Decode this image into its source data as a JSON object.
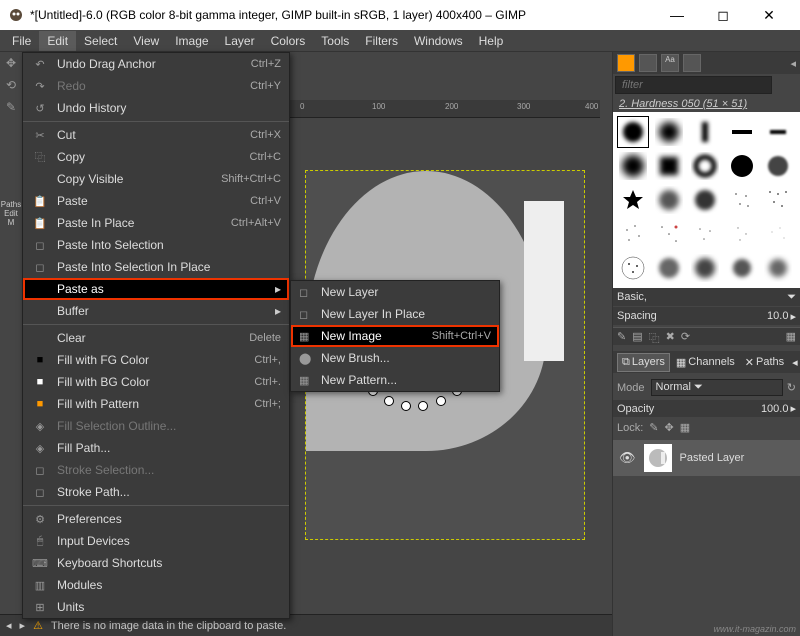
{
  "window": {
    "title": "*[Untitled]-6.0 (RGB color 8-bit gamma integer, GIMP built-in sRGB, 1 layer) 400x400 – GIMP",
    "min": "—",
    "max": "◻",
    "close": "✕"
  },
  "menubar": [
    "File",
    "Edit",
    "Select",
    "View",
    "Image",
    "Layer",
    "Colors",
    "Tools",
    "Filters",
    "Windows",
    "Help"
  ],
  "edit_menu": [
    {
      "icon": "↶",
      "label": "Undo Drag Anchor",
      "kbd": "Ctrl+Z",
      "type": "item"
    },
    {
      "icon": "↷",
      "label": "Redo",
      "kbd": "Ctrl+Y",
      "type": "disabled"
    },
    {
      "icon": "↺",
      "label": "Undo History",
      "kbd": "",
      "type": "item"
    },
    {
      "type": "sep"
    },
    {
      "icon": "✂",
      "label": "Cut",
      "kbd": "Ctrl+X",
      "type": "item"
    },
    {
      "icon": "⿻",
      "label": "Copy",
      "kbd": "Ctrl+C",
      "type": "item"
    },
    {
      "icon": "",
      "label": "Copy Visible",
      "kbd": "Shift+Ctrl+C",
      "type": "item"
    },
    {
      "icon": "📋",
      "label": "Paste",
      "kbd": "Ctrl+V",
      "type": "item"
    },
    {
      "icon": "📋",
      "label": "Paste In Place",
      "kbd": "Ctrl+Alt+V",
      "type": "item"
    },
    {
      "icon": "◻",
      "label": "Paste Into Selection",
      "kbd": "",
      "type": "item"
    },
    {
      "icon": "◻",
      "label": "Paste Into Selection In Place",
      "kbd": "",
      "type": "item"
    },
    {
      "icon": "",
      "label": "Paste as",
      "kbd": "",
      "type": "hilite",
      "arrow": "▸"
    },
    {
      "icon": "",
      "label": "Buffer",
      "kbd": "",
      "type": "item",
      "arrow": "▸"
    },
    {
      "type": "sep"
    },
    {
      "icon": "",
      "label": "Clear",
      "kbd": "Delete",
      "type": "item"
    },
    {
      "icon": "■",
      "label": "Fill with FG Color",
      "kbd": "Ctrl+,",
      "type": "item",
      "iconColor": "#000"
    },
    {
      "icon": "■",
      "label": "Fill with BG Color",
      "kbd": "Ctrl+.",
      "type": "item",
      "iconColor": "#fff"
    },
    {
      "icon": "■",
      "label": "Fill with Pattern",
      "kbd": "Ctrl+;",
      "type": "item",
      "iconColor": "#f90"
    },
    {
      "icon": "◈",
      "label": "Fill Selection Outline...",
      "kbd": "",
      "type": "disabled"
    },
    {
      "icon": "◈",
      "label": "Fill Path...",
      "kbd": "",
      "type": "item"
    },
    {
      "icon": "◻",
      "label": "Stroke Selection...",
      "kbd": "",
      "type": "disabled"
    },
    {
      "icon": "◻",
      "label": "Stroke Path...",
      "kbd": "",
      "type": "item"
    },
    {
      "type": "sep"
    },
    {
      "icon": "⚙",
      "label": "Preferences",
      "kbd": "",
      "type": "item"
    },
    {
      "icon": "🖱",
      "label": "Input Devices",
      "kbd": "",
      "type": "item"
    },
    {
      "icon": "⌨",
      "label": "Keyboard Shortcuts",
      "kbd": "",
      "type": "item"
    },
    {
      "icon": "▥",
      "label": "Modules",
      "kbd": "",
      "type": "item"
    },
    {
      "icon": "⊞",
      "label": "Units",
      "kbd": "",
      "type": "item"
    }
  ],
  "paste_as_menu": [
    {
      "icon": "◻",
      "label": "New Layer",
      "kbd": ""
    },
    {
      "icon": "◻",
      "label": "New Layer In Place",
      "kbd": ""
    },
    {
      "icon": "▦",
      "label": "New Image",
      "kbd": "Shift+Ctrl+V",
      "hilite": true
    },
    {
      "icon": "⬤",
      "label": "New Brush...",
      "kbd": ""
    },
    {
      "icon": "▦",
      "label": "New Pattern...",
      "kbd": ""
    }
  ],
  "ruler": [
    "0",
    "100",
    "200",
    "300",
    "400"
  ],
  "brushes": {
    "filter_placeholder": "filter",
    "name": "2. Hardness 050 (51 × 51)",
    "preset": "Basic,",
    "spacing_label": "Spacing",
    "spacing_value": "10.0"
  },
  "layers_panel": {
    "tabs": [
      "Layers",
      "Channels",
      "Paths"
    ],
    "mode_label": "Mode",
    "mode_value": "Normal",
    "opacity_label": "Opacity",
    "opacity_value": "100.0",
    "lock_label": "Lock:",
    "layer_name": "Pasted Layer"
  },
  "statusbar": {
    "warn_icon": "⚠",
    "text": "There is no image data in the clipboard to paste."
  },
  "paths_label1": "Paths",
  "paths_label2": "Edit M",
  "watermark": "www.it-magazin.com"
}
